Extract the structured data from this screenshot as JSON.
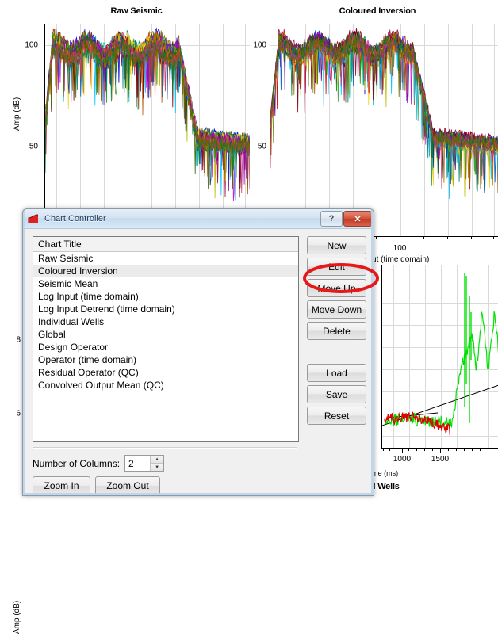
{
  "charts": [
    {
      "id": "raw-seismic",
      "title": "Raw Seismic",
      "ylabel": "Amp (dB)",
      "xlabel": "",
      "yticks": [
        "100",
        "50"
      ],
      "xticks": [],
      "type": "line"
    },
    {
      "id": "coloured-inversion",
      "title": "Coloured Inversion",
      "ylabel": "",
      "xlabel": "Coloured Output (time domain)",
      "yticks": [
        "100",
        "50"
      ],
      "xticks": [
        "100"
      ],
      "type": "line"
    },
    {
      "id": "individual-wells",
      "title": "Individual Wells",
      "ylabel": "Amp (dB)",
      "xlabel": "Time (ms)",
      "yticks": [
        "8",
        "6"
      ],
      "xticks": [
        "1000",
        "1500"
      ],
      "type": "line"
    }
  ],
  "chart_data": [
    {
      "type": "line",
      "title": "Raw Seismic",
      "xlabel": "",
      "ylabel": "Amp (dB)",
      "xscale": "log",
      "ylim": [
        10,
        115
      ],
      "yticks": [
        50,
        100
      ],
      "ytick_labels": [
        "50",
        "100"
      ],
      "grid": true,
      "legend": "none",
      "series_count": 24,
      "description": "Overlaid amplitude spectra of many seismic traces; flat plateau near 95-105 dB across low frequencies, steep roll-off, noise floor near 45-55 dB.",
      "envelope_x": [
        0,
        5,
        12,
        22,
        45,
        60,
        68,
        72,
        76,
        82,
        90,
        100
      ],
      "envelope_upper": [
        82,
        104,
        106,
        105,
        107,
        106,
        100,
        78,
        62,
        60,
        60,
        60
      ],
      "envelope_lower": [
        60,
        78,
        80,
        78,
        80,
        79,
        72,
        50,
        40,
        38,
        36,
        34
      ]
    },
    {
      "type": "line",
      "title": "Coloured Inversion",
      "xlabel": "Coloured Output (time domain)",
      "ylabel": "",
      "xscale": "log",
      "xticks": [
        100
      ],
      "xtick_labels": [
        "100"
      ],
      "ylim": [
        10,
        115
      ],
      "yticks": [
        50,
        100
      ],
      "ytick_labels": [
        "50",
        "100"
      ],
      "grid": true,
      "legend": "none",
      "series_count": 24,
      "description": "Overlaid amplitude spectra after coloured inversion; plateau near 95-105 dB, roll-off to a noise floor near 45-60 dB.",
      "envelope_x": [
        0,
        5,
        12,
        22,
        45,
        58,
        65,
        70,
        75,
        82,
        90,
        100
      ],
      "envelope_upper": [
        80,
        103,
        106,
        106,
        108,
        107,
        98,
        76,
        63,
        62,
        62,
        62
      ],
      "envelope_lower": [
        58,
        76,
        79,
        77,
        80,
        78,
        70,
        48,
        38,
        36,
        35,
        34
      ]
    },
    {
      "type": "line",
      "title": "Individual Wells",
      "xlabel": "Time (ms)",
      "ylabel": "Amp (dB)",
      "xticks": [
        1000,
        1500
      ],
      "xtick_labels": [
        "1000",
        "1500"
      ],
      "yticks": [
        6,
        8
      ],
      "ytick_labels": [
        "6",
        "8"
      ],
      "grid": true,
      "legend": "none",
      "series": [
        {
          "name": "green-trace",
          "color": "#00e000"
        },
        {
          "name": "red-trace",
          "color": "#e00000"
        },
        {
          "name": "trend-line-1",
          "color": "#000000"
        },
        {
          "name": "trend-line-2",
          "color": "#000000"
        }
      ],
      "description": "Green and red well amplitude traces versus time with two black linear trend lines; strong rising excursion after 1600 ms."
    }
  ],
  "dialog": {
    "title": "Chart Controller",
    "icon": "chart-red-icon",
    "titlebar_buttons": [
      {
        "name": "help-button",
        "label": "?"
      },
      {
        "name": "close-button",
        "label": "✕"
      }
    ],
    "list": {
      "header": "Chart Title",
      "selected": "Coloured Inversion",
      "items": [
        "Raw Seismic",
        "Coloured Inversion",
        "Seismic Mean",
        "Log Input (time domain)",
        "Log Input Detrend (time domain)",
        "Individual Wells",
        "Global",
        "Design Operator",
        "Operator (time domain)",
        "Residual Operator (QC)",
        "Convolved Output Mean (QC)"
      ]
    },
    "buttons": [
      {
        "name": "new-button",
        "label": "New"
      },
      {
        "name": "edit-button",
        "label": "Edit"
      },
      {
        "name": "move-up-button",
        "label": "Move Up"
      },
      {
        "name": "move-down-button",
        "label": "Move Down"
      },
      {
        "name": "delete-button",
        "label": "Delete"
      },
      {
        "name": "load-button",
        "label": "Load"
      },
      {
        "name": "save-button",
        "label": "Save"
      },
      {
        "name": "reset-button",
        "label": "Reset"
      }
    ],
    "columns": {
      "label": "Number of Columns:",
      "value": "2"
    },
    "zoom_buttons": [
      {
        "name": "zoom-in-button",
        "label": "Zoom In"
      },
      {
        "name": "zoom-out-button",
        "label": "Zoom Out"
      }
    ]
  },
  "annotation": {
    "name": "edit-highlight-ellipse",
    "color": "#e51919",
    "target": "Edit"
  }
}
